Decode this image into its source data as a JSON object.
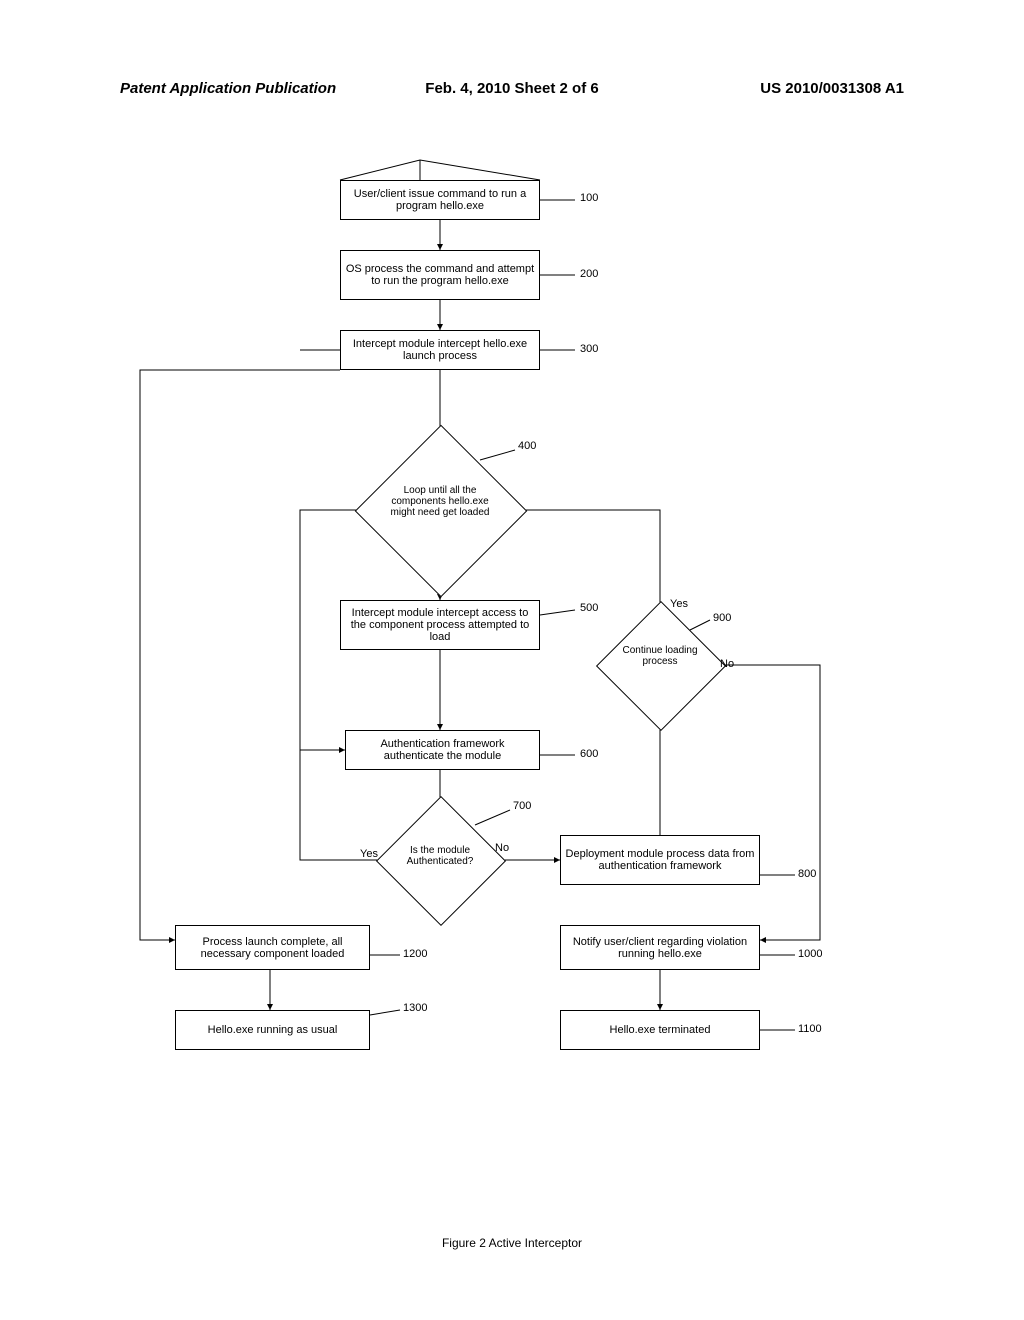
{
  "header": {
    "left": "Patent Application Publication",
    "center": "Feb. 4, 2010  Sheet 2 of 6",
    "right": "US 2010/0031308 A1"
  },
  "boxes": {
    "b100": "User/client issue command to run a program hello.exe",
    "b200": "OS process the command and attempt to run the program hello.exe",
    "b300": "Intercept module intercept hello.exe launch process",
    "b400": "Loop until all the components hello.exe might need get loaded",
    "b500": "Intercept module intercept access to the component process attempted to load",
    "b600": "Authentication framework authenticate the module",
    "b700": "Is the module Authenticated?",
    "b800": "Deployment module process data from authentication framework",
    "b900": "Continue loading process",
    "b1000": "Notify user/client regarding violation running hello.exe",
    "b1100": "Hello.exe terminated",
    "b1200": "Process launch complete, all necessary component loaded",
    "b1300": "Hello.exe running as usual"
  },
  "refs": {
    "r100": "100",
    "r200": "200",
    "r300": "300",
    "r400": "400",
    "r500": "500",
    "r600": "600",
    "r700": "700",
    "r800": "800",
    "r900": "900",
    "r1000": "1000",
    "r1100": "1100",
    "r1200": "1200",
    "r1300": "1300"
  },
  "edges": {
    "yes700": "Yes",
    "no700": "No",
    "yes900": "Yes",
    "no900": "No"
  },
  "caption": "Figure 2 Active Interceptor",
  "chart_data": {
    "type": "flowchart",
    "title": "Figure 2 Active Interceptor",
    "nodes": [
      {
        "id": 100,
        "shape": "process",
        "text": "User/client issue command to run a program hello.exe"
      },
      {
        "id": 200,
        "shape": "process",
        "text": "OS process the command and attempt to run the program hello.exe"
      },
      {
        "id": 300,
        "shape": "process",
        "text": "Intercept module intercept hello.exe launch process"
      },
      {
        "id": 400,
        "shape": "decision",
        "text": "Loop until all the components hello.exe might need get loaded"
      },
      {
        "id": 500,
        "shape": "process",
        "text": "Intercept module intercept access to the component process attempted to load"
      },
      {
        "id": 600,
        "shape": "process",
        "text": "Authentication framework authenticate the module"
      },
      {
        "id": 700,
        "shape": "decision",
        "text": "Is the module Authenticated?"
      },
      {
        "id": 800,
        "shape": "process",
        "text": "Deployment module process data from authentication framework"
      },
      {
        "id": 900,
        "shape": "decision",
        "text": "Continue loading process"
      },
      {
        "id": 1000,
        "shape": "process",
        "text": "Notify user/client regarding violation running hello.exe"
      },
      {
        "id": 1100,
        "shape": "process",
        "text": "Hello.exe terminated"
      },
      {
        "id": 1200,
        "shape": "process",
        "text": "Process launch complete, all necessary component loaded"
      },
      {
        "id": 1300,
        "shape": "process",
        "text": "Hello.exe running as usual"
      }
    ],
    "edges": [
      {
        "from": 100,
        "to": 200
      },
      {
        "from": 200,
        "to": 300
      },
      {
        "from": 300,
        "to": 400
      },
      {
        "from": 400,
        "to": 500
      },
      {
        "from": 500,
        "to": 600
      },
      {
        "from": 600,
        "to": 700
      },
      {
        "from": 700,
        "to": 800,
        "label": "No"
      },
      {
        "from": 700,
        "to": 400,
        "label": "Yes",
        "note": "loop back via left side"
      },
      {
        "from": 800,
        "to": 900
      },
      {
        "from": 900,
        "to": 400,
        "label": "Yes",
        "note": "loop back"
      },
      {
        "from": 900,
        "to": 1000,
        "label": "No"
      },
      {
        "from": 1000,
        "to": 1100
      },
      {
        "from": 300,
        "to": 1200,
        "note": "loop exit far-left"
      },
      {
        "from": 1200,
        "to": 1300
      }
    ]
  }
}
